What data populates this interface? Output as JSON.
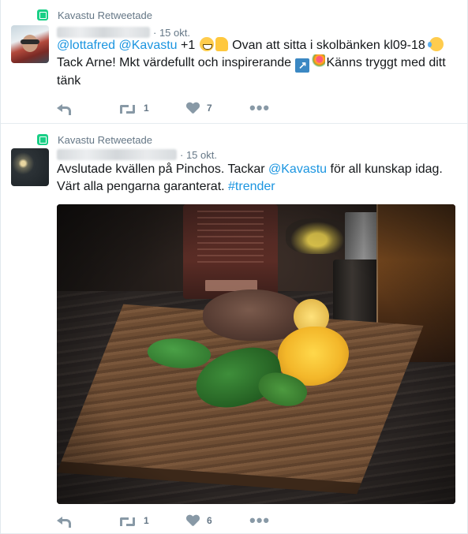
{
  "tweets": [
    {
      "retweet_label": "Kavastu Retweetade",
      "date": "15 okt.",
      "text": {
        "mention1": "@lottafred",
        "mention2": "@Kavastu",
        "part1": " +1 ",
        "part2": " Ovan att sitta i skolbänken kl09-18 ",
        "part3": "Tack Arne! Mkt värdefullt och inspirerande ",
        "part4": "Känns tryggt med ditt tänk"
      },
      "actions": {
        "retweet_count": "1",
        "like_count": "7",
        "more_label": "•••"
      }
    },
    {
      "retweet_label": "Kavastu Retweetade",
      "date": "15 okt.",
      "text": {
        "part1": "Avslutade kvällen på Pinchos. Tackar ",
        "mention": "@Kavastu",
        "part2": " för all kunskap idag. Värt alla pengarna garanterat. ",
        "hashtag": "#trender"
      },
      "actions": {
        "retweet_count": "1",
        "like_count": "6",
        "more_label": "•••"
      }
    }
  ],
  "icons": {
    "retweeted_by": "retweet-badge-icon",
    "reply": "reply-icon",
    "retweet": "retweet-icon",
    "like": "heart-icon",
    "more": "more-dots-icon"
  },
  "colors": {
    "link": "#1b95e0",
    "retweet_badge": "#19cf86",
    "muted_text": "#657786",
    "icon_gray": "#8899a6"
  }
}
